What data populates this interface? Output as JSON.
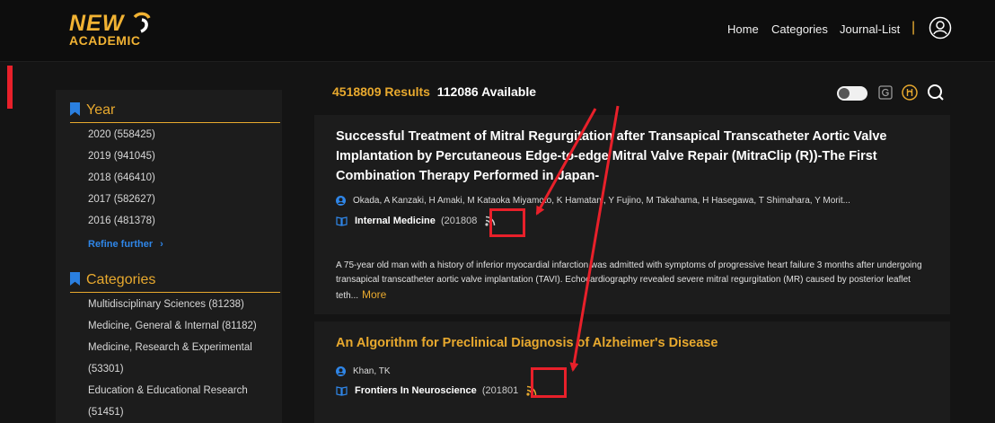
{
  "header": {
    "logo_line1": "NEW",
    "logo_line2": "ACADEMIC",
    "nav": [
      "Home",
      "Categories",
      "Journal-List"
    ],
    "separator": "|"
  },
  "sidebar": {
    "year_heading": "Year",
    "years": [
      "2020 (558425)",
      "2019 (941045)",
      "2018 (646410)",
      "2017 (582627)",
      "2016 (481378)"
    ],
    "refine": "Refine further",
    "categories_heading": "Categories",
    "categories": [
      "Multidisciplinary Sciences (81238)",
      "Medicine, General & Internal (81182)",
      "Medicine, Research & Experimental",
      "(53301)",
      "Education & Educational Research",
      "(51451)"
    ]
  },
  "results": {
    "count": "4518809 Results",
    "available": "112086 Available"
  },
  "articles": [
    {
      "title": "Successful Treatment of Mitral Regurgitation after Transapical Transcatheter Aortic Valve Implantation by Percutaneous Edge-to-edge Mitral Valve Repair (MitraClip (R))-The First Combination Therapy Performed in Japan-",
      "authors": "Okada, A   Kanzaki, H   Amaki, M   Kataoka   Miyamoto, K   Hamatani, Y   Fujino, M   Takahama, H   Hasegawa, T   Shimahara, Y   Morit...",
      "journal": "Internal Medicine",
      "year": "(201808",
      "abstract": "A 75-year old man with a history of inferior myocardial infarction was admitted with symptoms of progressive heart failure 3 months after undergoing transapical transcatheter aortic valve implantation (TAVI). Echocardiography revealed severe mitral regurgitation (MR) caused by posterior leaflet teth...",
      "more": "More"
    },
    {
      "title": "An Algorithm for Preclinical Diagnosis of Alzheimer's Disease",
      "authors": "Khan, TK",
      "journal": "Frontiers In Neuroscience",
      "year": "(201801"
    }
  ],
  "colors": {
    "accent": "#e8a92e",
    "link": "#2f86e8",
    "annotation": "#e8202a",
    "background": "#141414"
  }
}
